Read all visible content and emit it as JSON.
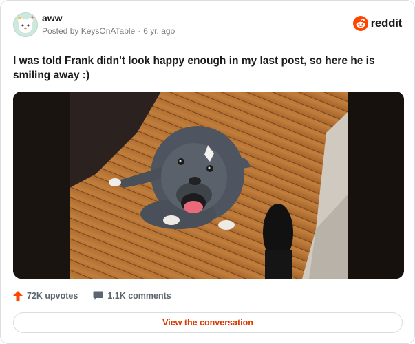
{
  "post": {
    "subreddit": "aww",
    "posted_by_prefix": "Posted by",
    "author": "KeysOnATable",
    "age": "6 yr. ago",
    "title": "I was told Frank didn't look happy enough in my last post, so here he is smiling away :)"
  },
  "brand": {
    "name": "reddit",
    "color": "#ff4500"
  },
  "stats": {
    "upvotes": "72K upvotes",
    "comments": "1.1K comments"
  },
  "cta": {
    "label": "View the conversation",
    "color": "#d93900"
  },
  "icons": {
    "subreddit": "subreddit-avatar-icon",
    "brand": "reddit-logo-icon",
    "upvote": "upvote-arrow-icon",
    "comment": "comment-bubble-icon"
  },
  "image": {
    "subject": "dog on wooden floor"
  }
}
